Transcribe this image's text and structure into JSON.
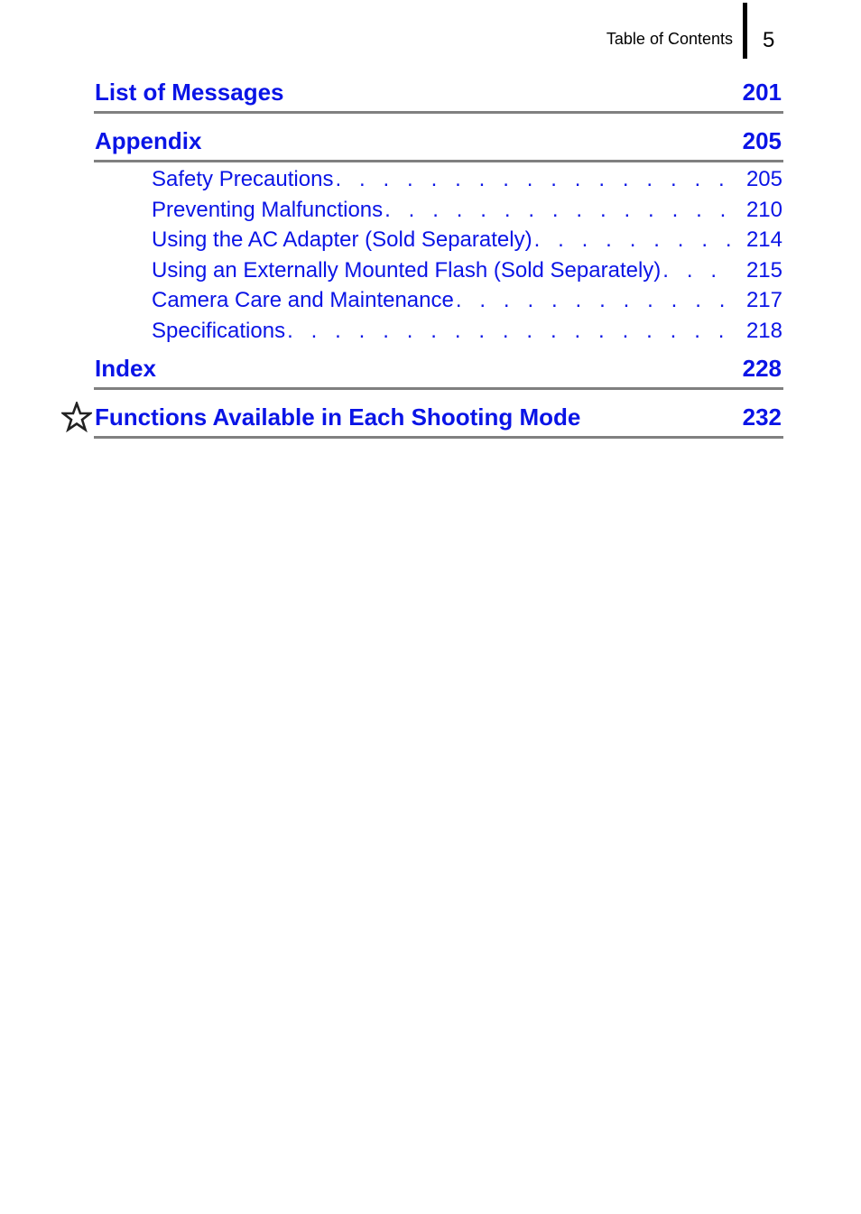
{
  "header": {
    "label": "Table of Contents",
    "page_number": "5"
  },
  "sections": [
    {
      "title": "List of Messages",
      "page": "201"
    },
    {
      "title": "Appendix",
      "page": "205"
    },
    {
      "title": "Index",
      "page": "228"
    },
    {
      "title": "Functions Available in Each Shooting Mode",
      "page": "232",
      "icon": "star-outline-icon"
    }
  ],
  "appendix_entries": [
    {
      "title": "Safety Precautions",
      "page": "205"
    },
    {
      "title": "Preventing Malfunctions",
      "page": "210"
    },
    {
      "title": "Using the AC Adapter (Sold Separately)",
      "page": "214"
    },
    {
      "title": "Using an Externally Mounted Flash (Sold Separately)",
      "page": "215"
    },
    {
      "title": "Camera Care and Maintenance",
      "page": "217"
    },
    {
      "title": "Specifications",
      "page": "218"
    }
  ],
  "leader": ". . . . . . . . . . . . . . . . . . . . . . . . . . . . . . . . . . . . . . . . . . . . . . . . . . . . . . . . . . ."
}
